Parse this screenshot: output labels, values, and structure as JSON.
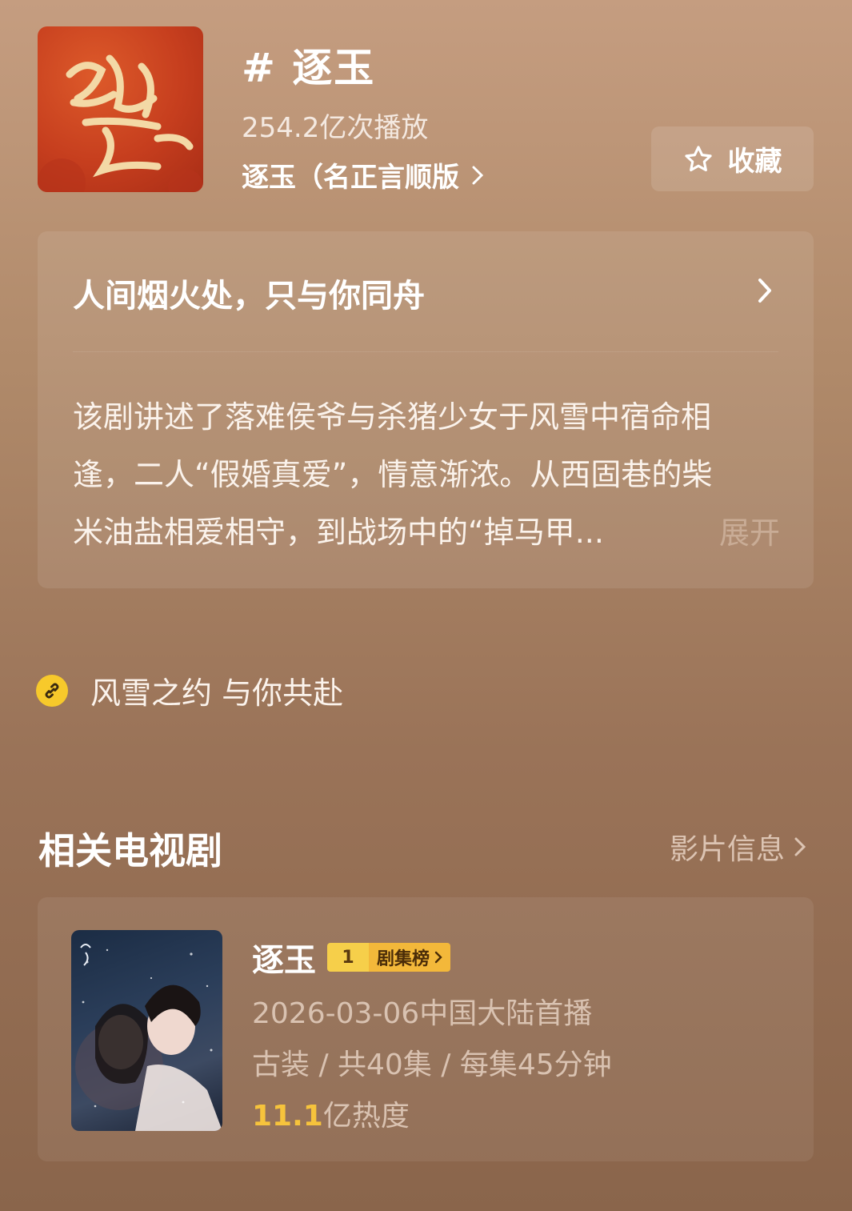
{
  "header": {
    "cover_text": "逐玉",
    "topic_title": "# 逐玉",
    "play_count": "254.2亿次播放",
    "sub_link": "逐玉（名正言顺版",
    "favorite_label": "收藏"
  },
  "intro": {
    "headline": "人间烟火处，只与你同舟",
    "lines": [
      "该剧讲述了落难侯爷与杀猪少女于风雪中宿命相",
      "逢，二人“假婚真爱”，情意渐浓。从西固巷的柴",
      "米油盐相爱相守，到战场中的“掉马甲..."
    ],
    "expand_label": "展开"
  },
  "link_row": {
    "text": "风雪之约 与你共赴"
  },
  "related": {
    "section_title": "相关电视剧",
    "more_label": "影片信息",
    "drama": {
      "title": "逐玉",
      "rank_number": "1",
      "rank_label": "剧集榜",
      "premiere": "2026-03-06中国大陆首播",
      "info": "古装 / 共40集 / 每集45分钟",
      "heat_value": "11.1",
      "heat_unit": "亿热度"
    }
  },
  "colors": {
    "accent_gold": "#f6c33c",
    "link_icon_yellow": "#f7c92b",
    "cover_red": "#c63e1e"
  }
}
